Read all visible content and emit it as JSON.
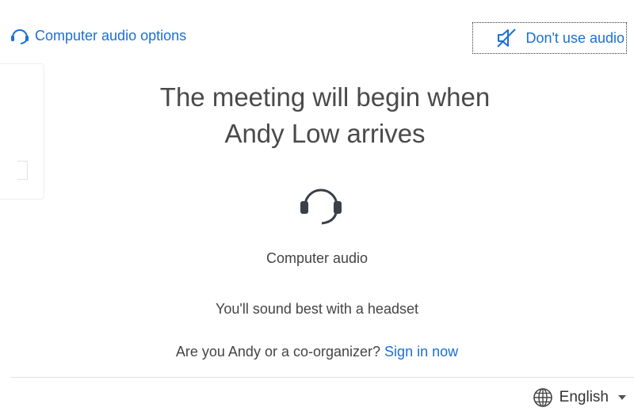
{
  "header": {
    "audio_options_label": "Computer audio options",
    "no_audio_label": "Don't use audio"
  },
  "main": {
    "heading_line1": "The meeting will begin when",
    "heading_line2": "Andy Low arrives",
    "audio_mode_label": "Computer audio",
    "tip": "You'll sound best with a headset",
    "signin_prompt": "Are you Andy or a co-organizer?",
    "signin_link": "Sign in now"
  },
  "footer": {
    "language": "English"
  },
  "icons": {
    "audio_options": "headset-icon",
    "no_audio": "speaker-muted-icon",
    "main": "headset-icon",
    "language": "globe-icon",
    "dropdown": "caret-down-icon"
  },
  "colors": {
    "link": "#1a6fd6",
    "text": "#444444",
    "heading": "#4a4a4a"
  }
}
